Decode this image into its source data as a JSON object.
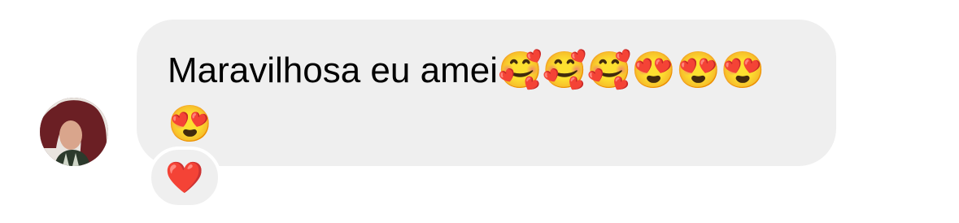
{
  "message": {
    "text": "Maravilhosa eu amei🥰🥰🥰😍😍😍😍",
    "sender_avatar": "user-avatar-photo"
  },
  "reaction": {
    "emoji": "❤️",
    "icon": "heart-icon"
  },
  "colors": {
    "bubble_bg": "#efefef",
    "text": "#000000",
    "heart": "#e8202a"
  }
}
